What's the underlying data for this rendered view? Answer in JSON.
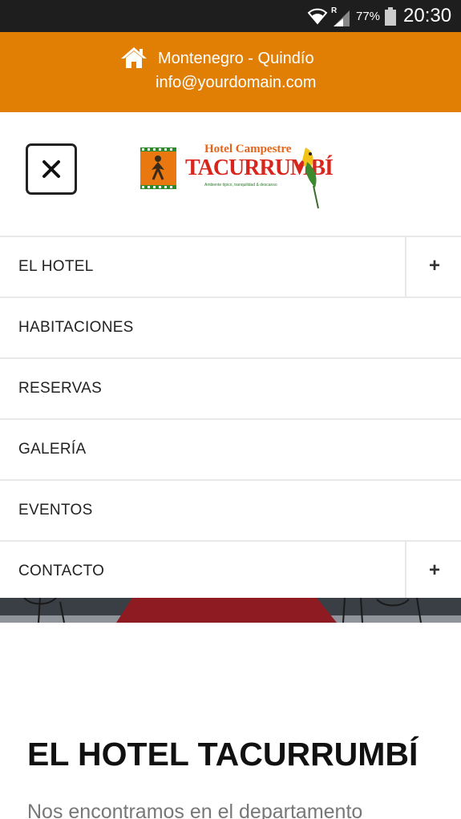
{
  "status_bar": {
    "wifi_icon": "wifi-icon",
    "network_label": "R",
    "signal_icon": "signal-icon",
    "battery_percent": "77%",
    "battery_icon": "battery-icon",
    "time": "20:30"
  },
  "topbar": {
    "home_icon": "home-icon",
    "location": "Montenegro - Quindío",
    "email": "info@yourdomain.com",
    "color": "#e17f05"
  },
  "header": {
    "close_icon": "close-icon",
    "logo": {
      "line1": "Hotel Campestre",
      "line2": "TACURRUMBÍ",
      "tagline": "Ambiente típico, tranquilidad & descanso"
    }
  },
  "menu": {
    "items": [
      {
        "label": "EL HOTEL",
        "has_submenu": true,
        "toggle": "+"
      },
      {
        "label": "HABITACIONES",
        "has_submenu": false
      },
      {
        "label": "RESERVAS",
        "has_submenu": false
      },
      {
        "label": "GALERÍA",
        "has_submenu": false
      },
      {
        "label": "EVENTOS",
        "has_submenu": false
      },
      {
        "label": "CONTACTO",
        "has_submenu": true,
        "toggle": "+"
      }
    ]
  },
  "content": {
    "title": "EL HOTEL TACURRUMBÍ",
    "intro": "Nos encontramos en el departamento"
  }
}
